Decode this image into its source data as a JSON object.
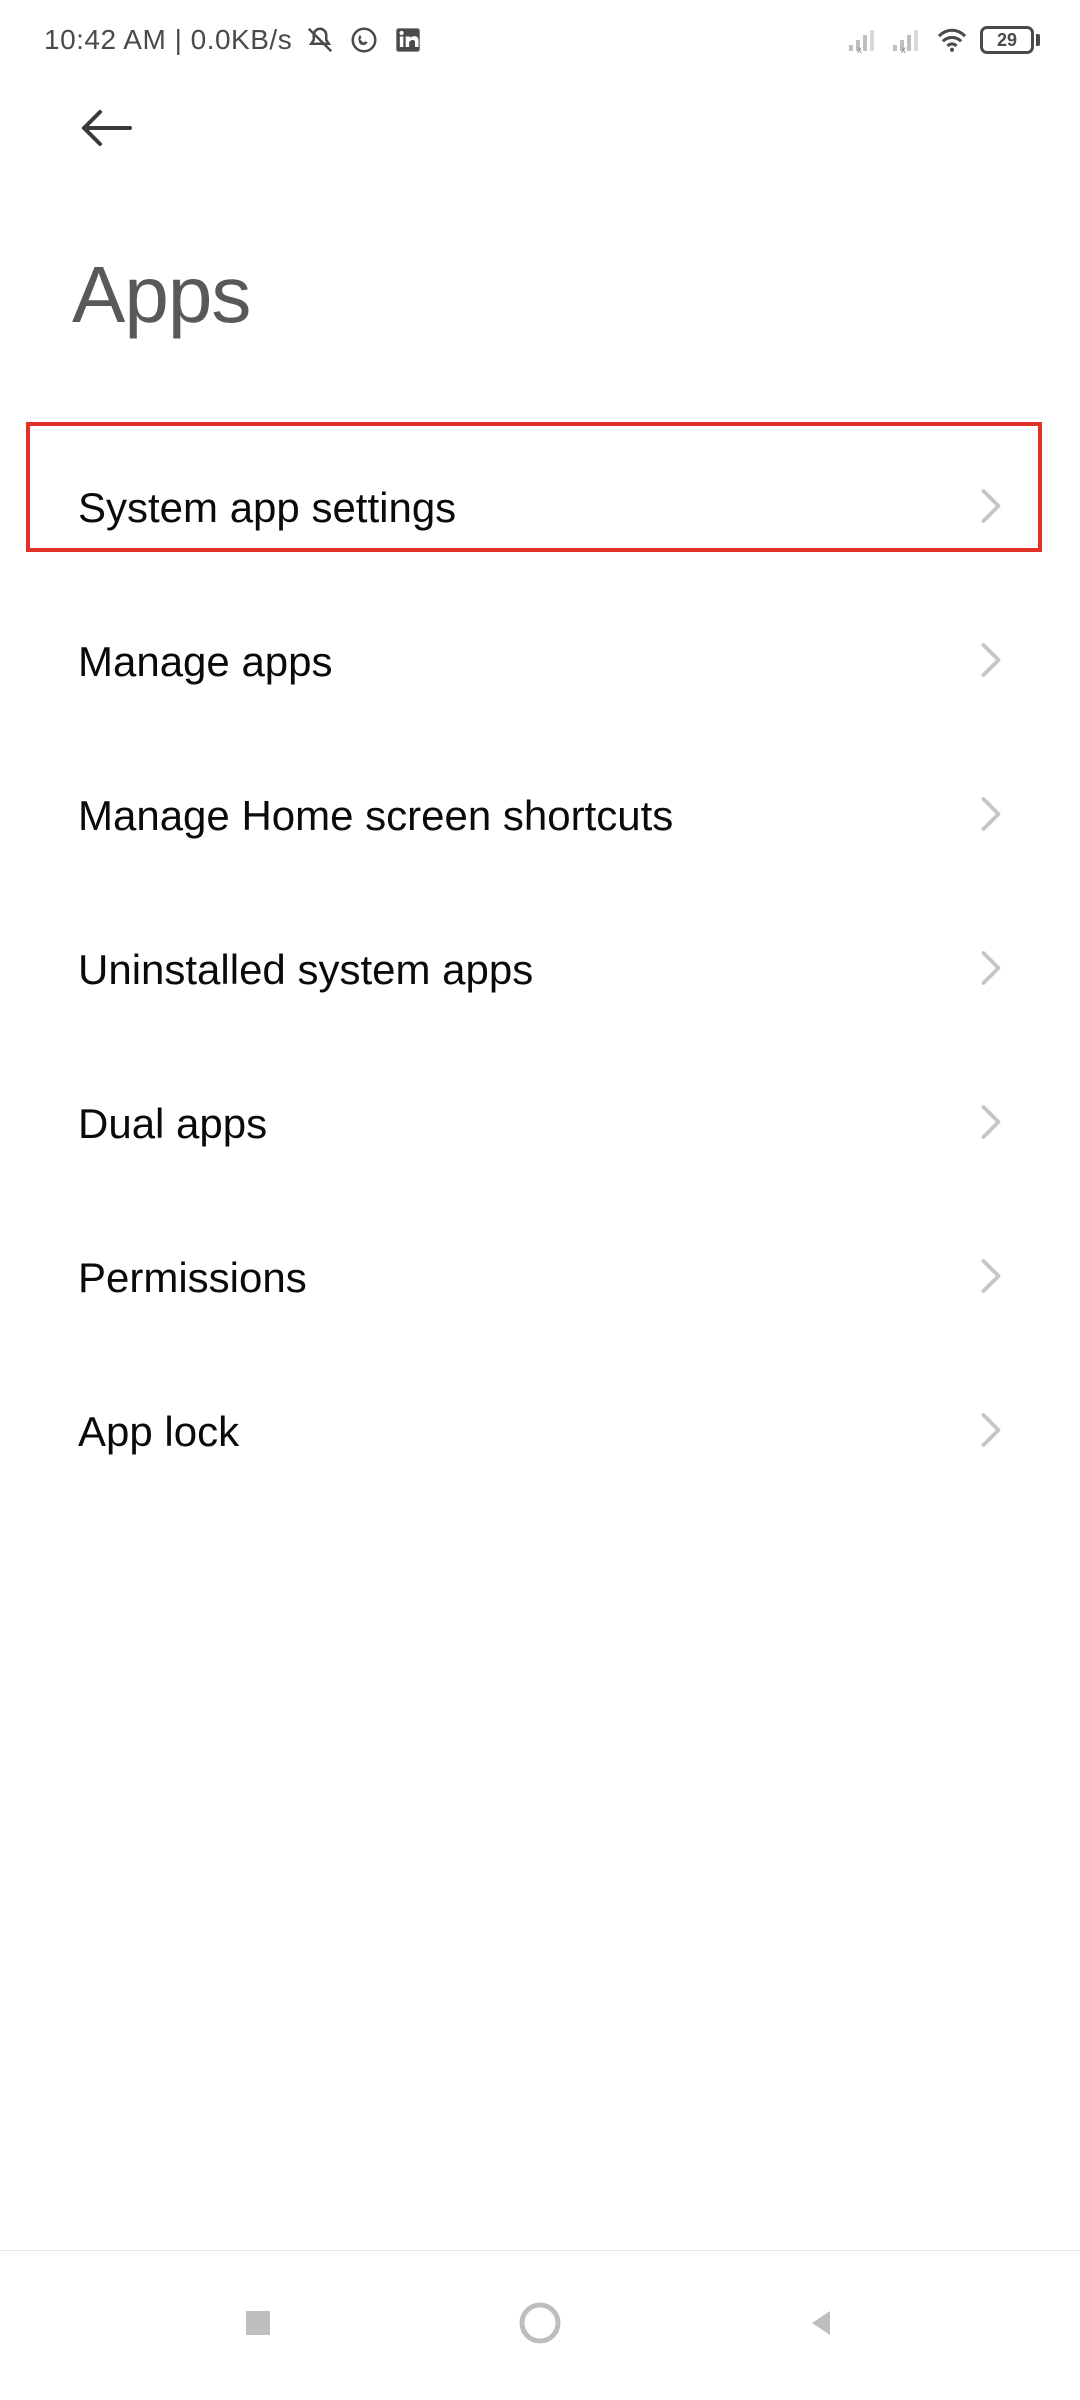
{
  "statusbar": {
    "time_net": "10:42 AM | 0.0KB/s",
    "battery_pct": "29"
  },
  "header": {
    "title": "Apps"
  },
  "rows": [
    {
      "label": "System app settings"
    },
    {
      "label": "Manage apps"
    },
    {
      "label": "Manage Home screen shortcuts"
    },
    {
      "label": "Uninstalled system apps"
    },
    {
      "label": "Dual apps"
    },
    {
      "label": "Permissions"
    },
    {
      "label": "App lock"
    }
  ]
}
